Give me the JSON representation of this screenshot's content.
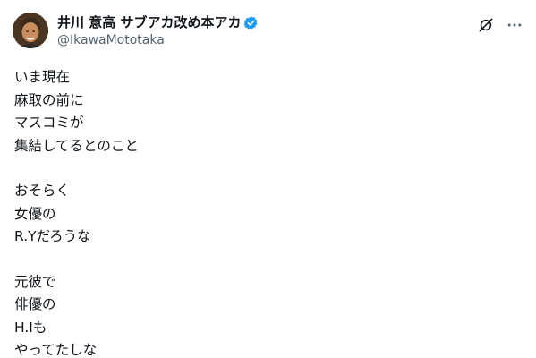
{
  "author": {
    "display_name": "井川 意高 サブアカ改め本アカ",
    "handle": "@IkawaMototaka",
    "verified": true,
    "avatar_icon": "profile-photo",
    "verified_color": "#1d9bf0"
  },
  "actions": {
    "grok_icon": "grok-slash-icon",
    "more_icon": "more-horizontal-icon"
  },
  "post": {
    "paragraphs": [
      [
        "いま現在",
        "麻取の前に",
        "マスコミが",
        "集結してるとのこと"
      ],
      [
        "おそらく",
        "女優の",
        "R.Yだろうな"
      ],
      [
        "元彼で",
        "俳優の",
        "H.Iも",
        "やってたしな"
      ]
    ]
  }
}
